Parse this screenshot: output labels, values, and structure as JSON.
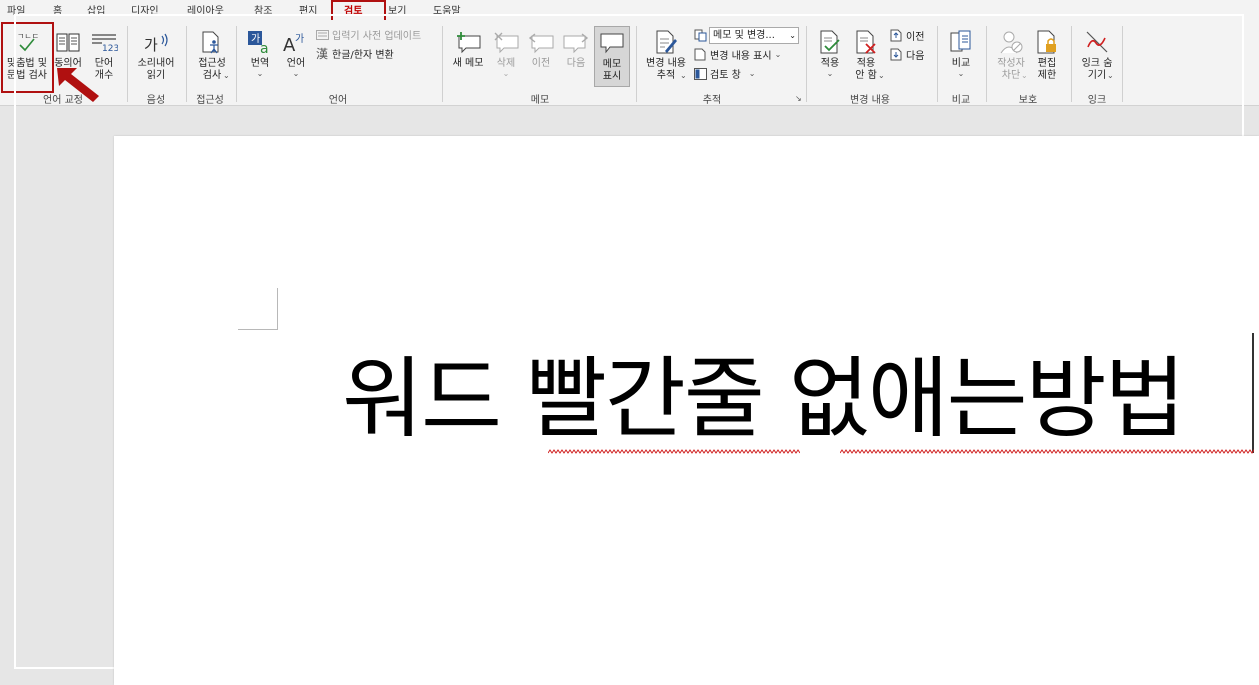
{
  "tabs": [
    {
      "id": "file",
      "label": "파일",
      "active": false
    },
    {
      "id": "home",
      "label": "홈",
      "active": false
    },
    {
      "id": "insert",
      "label": "삽입",
      "active": false
    },
    {
      "id": "design",
      "label": "디자인",
      "active": false
    },
    {
      "id": "layout",
      "label": "레이아웃",
      "active": false
    },
    {
      "id": "references",
      "label": "참조",
      "active": false
    },
    {
      "id": "mailings",
      "label": "편지",
      "active": false
    },
    {
      "id": "review",
      "label": "검토",
      "active": true
    },
    {
      "id": "view",
      "label": "보기",
      "active": false
    },
    {
      "id": "help",
      "label": "도움말",
      "active": false
    }
  ],
  "ribbon": {
    "proofing": {
      "spelling_label": "맞춤법 및\n문법 검사",
      "thesaurus_label": "동의어",
      "wordcount_label": "단어\n개수",
      "group_label": "언어 교정"
    },
    "speech": {
      "read_aloud_label": "소리내어\n읽기",
      "group_label": "음성"
    },
    "accessibility": {
      "check_label": "접근성\n검사",
      "group_label": "접근성"
    },
    "language": {
      "translate_label": "번역",
      "language_label": "언어",
      "ime_update_label": "입력기 사전 업데이트",
      "hanja_label": "한글/한자 변환",
      "group_label": "언어"
    },
    "comments": {
      "new_label": "새 메모",
      "delete_label": "삭제",
      "prev_label": "이전",
      "next_label": "다음",
      "show_label": "메모\n표시",
      "group_label": "메모"
    },
    "tracking": {
      "track_label": "변경 내용\n추적",
      "display_select_value": "메모 및 변경...",
      "show_markup_label": "변경 내용 표시",
      "review_pane_label": "검토 창",
      "group_label": "추적"
    },
    "changes": {
      "accept_label": "적용",
      "reject_label": "적용\n안 함",
      "prev_label": "이전",
      "next_label": "다음",
      "group_label": "변경 내용"
    },
    "compare": {
      "compare_label": "비교",
      "group_label": "비교"
    },
    "protect": {
      "block_authors_label": "작성자\n차단",
      "restrict_label": "편집\n제한",
      "group_label": "보호"
    },
    "ink": {
      "hide_ink_label": "잉크 숨\n기기",
      "group_label": "잉크"
    }
  },
  "document": {
    "text": "워드  빨간줄  없애는방법"
  },
  "colors": {
    "annotation_red": "#b01010",
    "accent_blue": "#2b579a",
    "accent_green": "#2e8b3a",
    "squiggle_red": "#d02020"
  }
}
